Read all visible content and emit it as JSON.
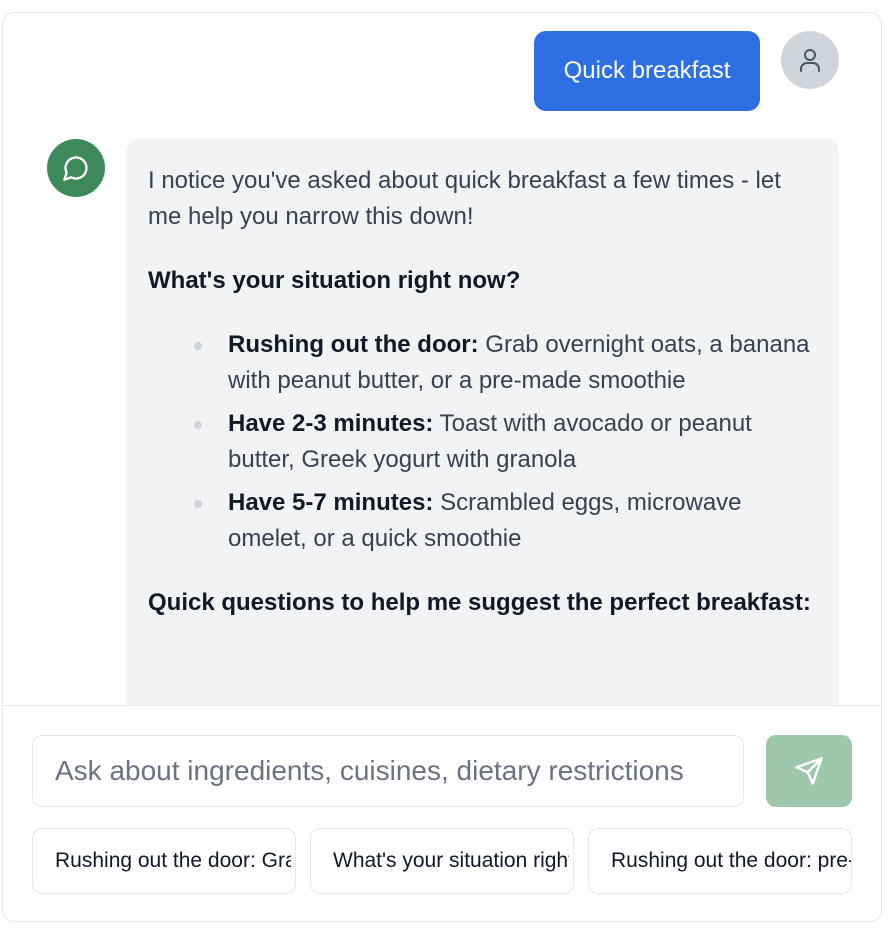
{
  "conversation": {
    "user_message": "Quick breakfast",
    "assistant": {
      "intro": "I notice you've asked about quick breakfast a few times - let me help you narrow this down!",
      "situation_heading": "What's your situation right now?",
      "options": [
        {
          "label": "Rushing out the door:",
          "text": " Grab overnight oats, a banana with peanut butter, or a pre-made smoothie"
        },
        {
          "label": "Have 2-3 minutes:",
          "text": " Toast with avocado or peanut butter, Greek yogurt with granola"
        },
        {
          "label": "Have 5-7 minutes:",
          "text": " Scrambled eggs, microwave omelet, or a quick smoothie"
        }
      ],
      "questions_heading": "Quick questions to help me suggest the perfect breakfast:"
    }
  },
  "composer": {
    "placeholder": "Ask about ingredients, cuisines, dietary restrictions",
    "value": ""
  },
  "suggestions": [
    "Rushing out the door: Grab overnight oats",
    "What's your situation right now?",
    "Rushing out the door: pre-made smoothie"
  ],
  "icons": {
    "user_avatar": "user-icon",
    "bot_avatar": "chat-bubble-icon",
    "send": "send-icon"
  },
  "colors": {
    "user_bubble": "#2f6fe4",
    "bot_avatar": "#3e8a5a",
    "send_button": "#9ec8ab",
    "bot_bubble": "#f2f3f5"
  }
}
